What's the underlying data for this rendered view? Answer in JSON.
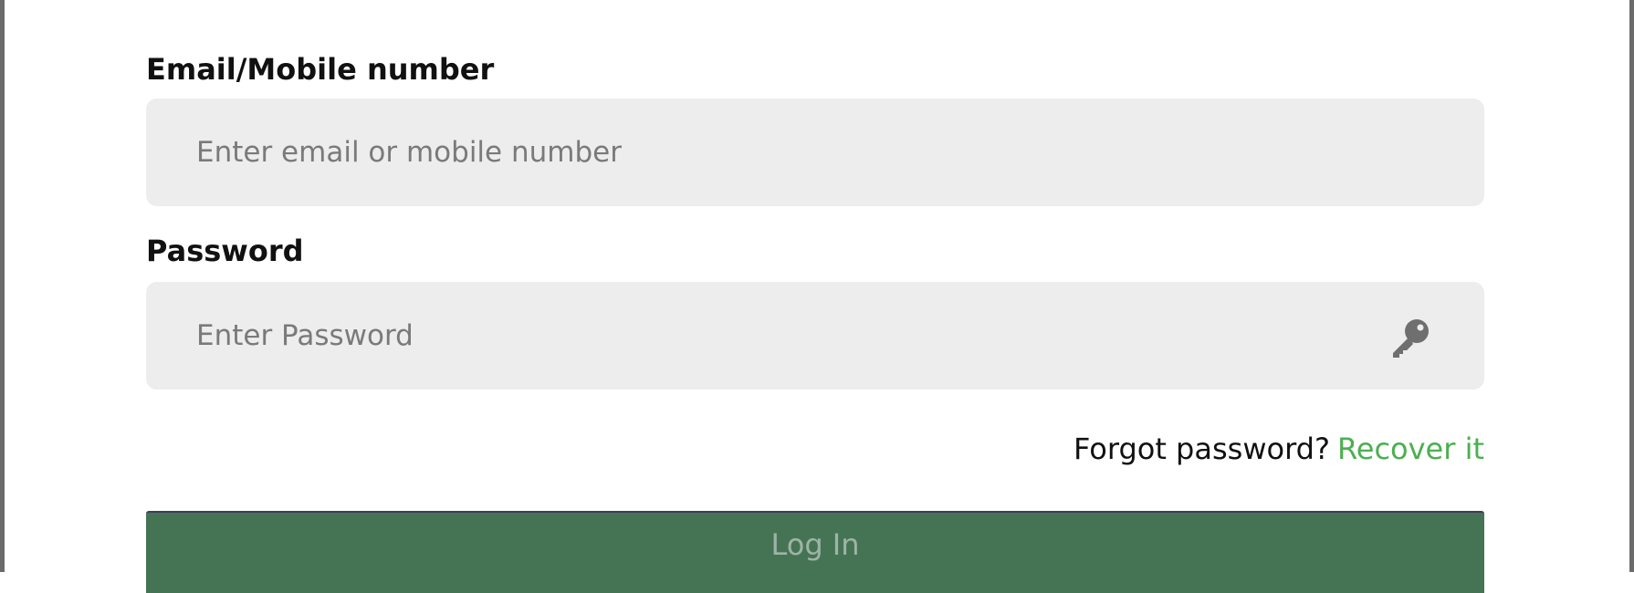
{
  "form": {
    "email": {
      "label": "Email/Mobile number",
      "placeholder": "Enter email or mobile number",
      "value": ""
    },
    "password": {
      "label": "Password",
      "placeholder": "Enter Password",
      "value": "",
      "icon": "key-icon"
    },
    "forgot": {
      "text": "Forgot password?",
      "link_label": "Recover it"
    },
    "login_button_label": "Log In"
  },
  "colors": {
    "input_background": "#ededed",
    "link_accent": "#4caf50",
    "button_background": "#457455",
    "button_text": "#9fb4a6"
  }
}
